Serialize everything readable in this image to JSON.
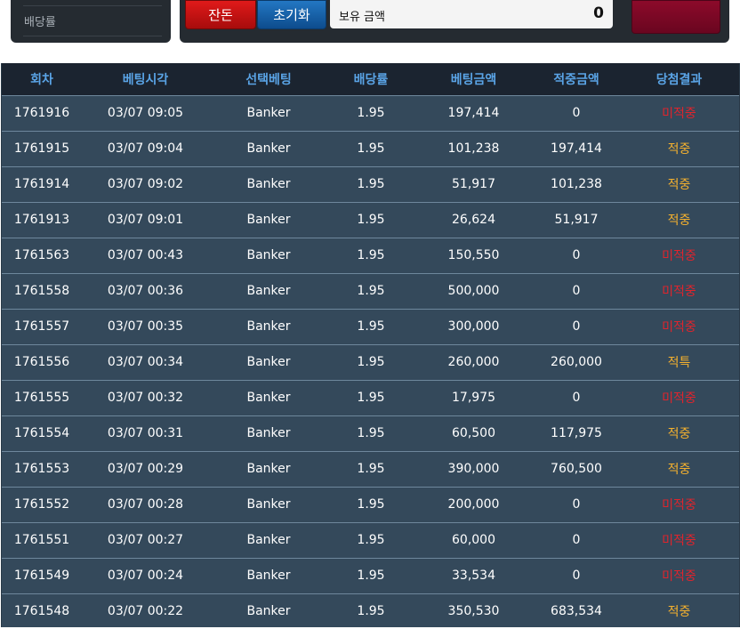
{
  "left_panel": {
    "label": "배당률"
  },
  "controls": {
    "balance_button": "잔돈",
    "reset_button": "초기화",
    "holding_label": "보유 금액",
    "holding_value": "0"
  },
  "colors": {
    "miss": "#e0242c",
    "hit": "#f5b12e",
    "header_text": "#5aa4e6"
  },
  "table": {
    "headers": [
      "회차",
      "베팅시각",
      "선택베팅",
      "배당률",
      "베팅금액",
      "적중금액",
      "당첨결과"
    ],
    "rows": [
      [
        "1761916",
        "03/07 09:05",
        "Banker",
        "1.95",
        "197,414",
        "0",
        "미적중"
      ],
      [
        "1761915",
        "03/07 09:04",
        "Banker",
        "1.95",
        "101,238",
        "197,414",
        "적중"
      ],
      [
        "1761914",
        "03/07 09:02",
        "Banker",
        "1.95",
        "51,917",
        "101,238",
        "적중"
      ],
      [
        "1761913",
        "03/07 09:01",
        "Banker",
        "1.95",
        "26,624",
        "51,917",
        "적중"
      ],
      [
        "1761563",
        "03/07 00:43",
        "Banker",
        "1.95",
        "150,550",
        "0",
        "미적중"
      ],
      [
        "1761558",
        "03/07 00:36",
        "Banker",
        "1.95",
        "500,000",
        "0",
        "미적중"
      ],
      [
        "1761557",
        "03/07 00:35",
        "Banker",
        "1.95",
        "300,000",
        "0",
        "미적중"
      ],
      [
        "1761556",
        "03/07 00:34",
        "Banker",
        "1.95",
        "260,000",
        "260,000",
        "적특"
      ],
      [
        "1761555",
        "03/07 00:32",
        "Banker",
        "1.95",
        "17,975",
        "0",
        "미적중"
      ],
      [
        "1761554",
        "03/07 00:31",
        "Banker",
        "1.95",
        "60,500",
        "117,975",
        "적중"
      ],
      [
        "1761553",
        "03/07 00:29",
        "Banker",
        "1.95",
        "390,000",
        "760,500",
        "적중"
      ],
      [
        "1761552",
        "03/07 00:28",
        "Banker",
        "1.95",
        "200,000",
        "0",
        "미적중"
      ],
      [
        "1761551",
        "03/07 00:27",
        "Banker",
        "1.95",
        "60,000",
        "0",
        "미적중"
      ],
      [
        "1761549",
        "03/07 00:24",
        "Banker",
        "1.95",
        "33,534",
        "0",
        "미적중"
      ],
      [
        "1761548",
        "03/07 00:22",
        "Banker",
        "1.95",
        "350,530",
        "683,534",
        "적중"
      ]
    ]
  }
}
